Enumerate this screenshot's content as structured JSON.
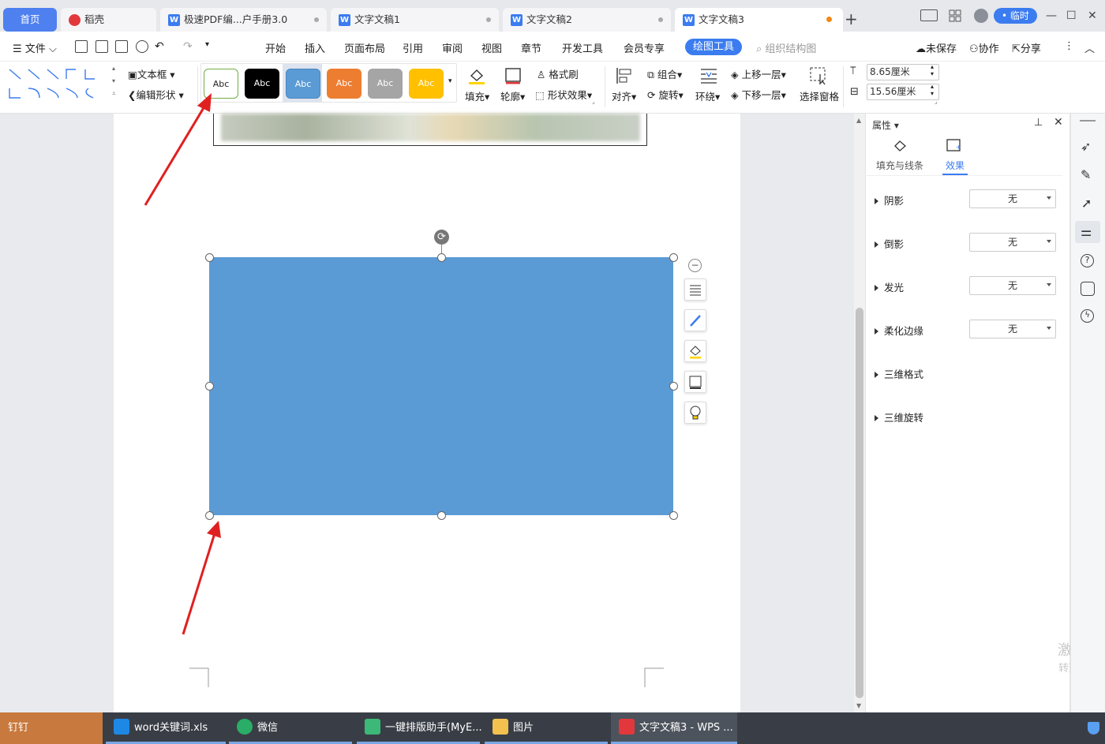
{
  "tabs": {
    "home": "首页",
    "daoke": "稻壳",
    "pdf": "极速PDF编...户手册3.0",
    "doc1": "文字文稿1",
    "doc2": "文字文稿2",
    "doc3": "文字文稿3",
    "add": "+"
  },
  "titlebar": {
    "temp_user": "• 临时",
    "minimize": "—",
    "maximize": "☐",
    "close": "✕"
  },
  "menu": {
    "file": "文件",
    "items": [
      "开始",
      "插入",
      "页面布局",
      "引用",
      "审阅",
      "视图",
      "章节",
      "开发工具",
      "会员专享"
    ],
    "active": "绘图工具",
    "search": "组织结构图",
    "unsaved": "未保存",
    "collab": "协作",
    "share": "分享",
    "more": "⋮",
    "collapse": "︿"
  },
  "ribbon": {
    "textbox": "文本框",
    "edit_shape": "编辑形状",
    "style_label": "Abc",
    "style_colors": [
      "#ffffff",
      "#000000",
      "#5b9bd5",
      "#ed7d31",
      "#a5a5a5",
      "#ffc000"
    ],
    "fill": "填充",
    "outline": "轮廓",
    "format_painter": "格式刷",
    "shape_effects": "形状效果",
    "align": "对齐",
    "group": "组合",
    "rotate": "旋转",
    "wrap": "环绕",
    "bring_forward": "上移一层",
    "send_backward": "下移一层",
    "selection_pane": "选择窗格",
    "height": "8.65厘米",
    "width": "15.56厘米"
  },
  "shape": {
    "fill_color": "#5b9bd5"
  },
  "panel": {
    "title": "属性",
    "tab_fill": "填充与线条",
    "tab_effect": "效果",
    "rows": [
      {
        "label": "阴影",
        "value": "无"
      },
      {
        "label": "倒影",
        "value": "无"
      },
      {
        "label": "发光",
        "value": "无"
      },
      {
        "label": "柔化边缘",
        "value": "无"
      },
      {
        "label": "三维格式"
      },
      {
        "label": "三维旋转"
      }
    ]
  },
  "watermark": {
    "line1": "激活 W",
    "line2": "转到\"设置"
  },
  "taskbar": {
    "items": [
      "钉钉",
      "word关键词.xls",
      "微信",
      "一键排版助手(MyE...",
      "图片",
      "文字文稿3 - WPS ..."
    ]
  }
}
